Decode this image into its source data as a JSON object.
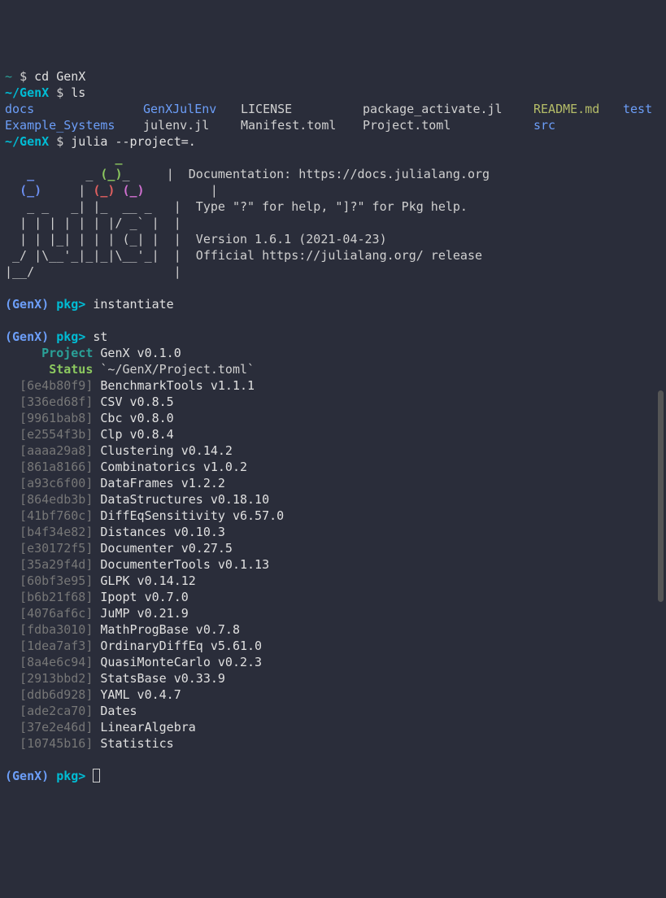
{
  "prompt": {
    "tilde": "~",
    "dollar": "$",
    "path_genx": "~/GenX"
  },
  "cmd": {
    "cd": "cd GenX",
    "ls": "ls",
    "julia": "julia --project=."
  },
  "ls": {
    "c0a": "docs",
    "c0b": "Example_Systems",
    "c1a": "GenXJulEnv",
    "c1b": "julenv.jl",
    "c2a": "LICENSE",
    "c2b": "Manifest.toml",
    "c3a": "package_activate.jl",
    "c3b": "Project.toml",
    "c4a": "README.md",
    "c4b": "src",
    "c5a": "test"
  },
  "banner": {
    "l1a": "_",
    "l2a": "(_)",
    "l2b": "(_)",
    "l2c": "(_)",
    "l3": "   _ _   _| |_  __ _   |  Type \"?\" for help, \"]?\" for Pkg help.",
    "l4": "  | | | | | | |/ _` |  |",
    "l5": "  | | |_| | | | (_| |  |  Version 1.6.1 (2021-04-23)",
    "l6": " _/ |\\__'_|_|_|\\__'_|  |  Official https://julialang.org/ release",
    "l7": "|__/                   |",
    "doc": "|  Documentation: https://docs.julialang.org",
    "pipes": "     |"
  },
  "pkg": {
    "env": "(GenX)",
    "prompt": "pkg>",
    "cmd1": "instantiate",
    "cmd2": "st",
    "proj_label": "Project",
    "proj_val": "GenX v0.1.0",
    "status_label": "Status",
    "status_val": "`~/GenX/Project.toml`"
  },
  "deps": [
    {
      "id": "[6e4b80f9]",
      "name": "BenchmarkTools v1.1.1"
    },
    {
      "id": "[336ed68f]",
      "name": "CSV v0.8.5"
    },
    {
      "id": "[9961bab8]",
      "name": "Cbc v0.8.0"
    },
    {
      "id": "[e2554f3b]",
      "name": "Clp v0.8.4"
    },
    {
      "id": "[aaaa29a8]",
      "name": "Clustering v0.14.2"
    },
    {
      "id": "[861a8166]",
      "name": "Combinatorics v1.0.2"
    },
    {
      "id": "[a93c6f00]",
      "name": "DataFrames v1.2.2"
    },
    {
      "id": "[864edb3b]",
      "name": "DataStructures v0.18.10"
    },
    {
      "id": "[41bf760c]",
      "name": "DiffEqSensitivity v6.57.0"
    },
    {
      "id": "[b4f34e82]",
      "name": "Distances v0.10.3"
    },
    {
      "id": "[e30172f5]",
      "name": "Documenter v0.27.5"
    },
    {
      "id": "[35a29f4d]",
      "name": "DocumenterTools v0.1.13"
    },
    {
      "id": "[60bf3e95]",
      "name": "GLPK v0.14.12"
    },
    {
      "id": "[b6b21f68]",
      "name": "Ipopt v0.7.0"
    },
    {
      "id": "[4076af6c]",
      "name": "JuMP v0.21.9"
    },
    {
      "id": "[fdba3010]",
      "name": "MathProgBase v0.7.8"
    },
    {
      "id": "[1dea7af3]",
      "name": "OrdinaryDiffEq v5.61.0"
    },
    {
      "id": "[8a4e6c94]",
      "name": "QuasiMonteCarlo v0.2.3"
    },
    {
      "id": "[2913bbd2]",
      "name": "StatsBase v0.33.9"
    },
    {
      "id": "[ddb6d928]",
      "name": "YAML v0.4.7"
    },
    {
      "id": "[ade2ca70]",
      "name": "Dates"
    },
    {
      "id": "[37e2e46d]",
      "name": "LinearAlgebra"
    },
    {
      "id": "[10745b16]",
      "name": "Statistics"
    }
  ]
}
